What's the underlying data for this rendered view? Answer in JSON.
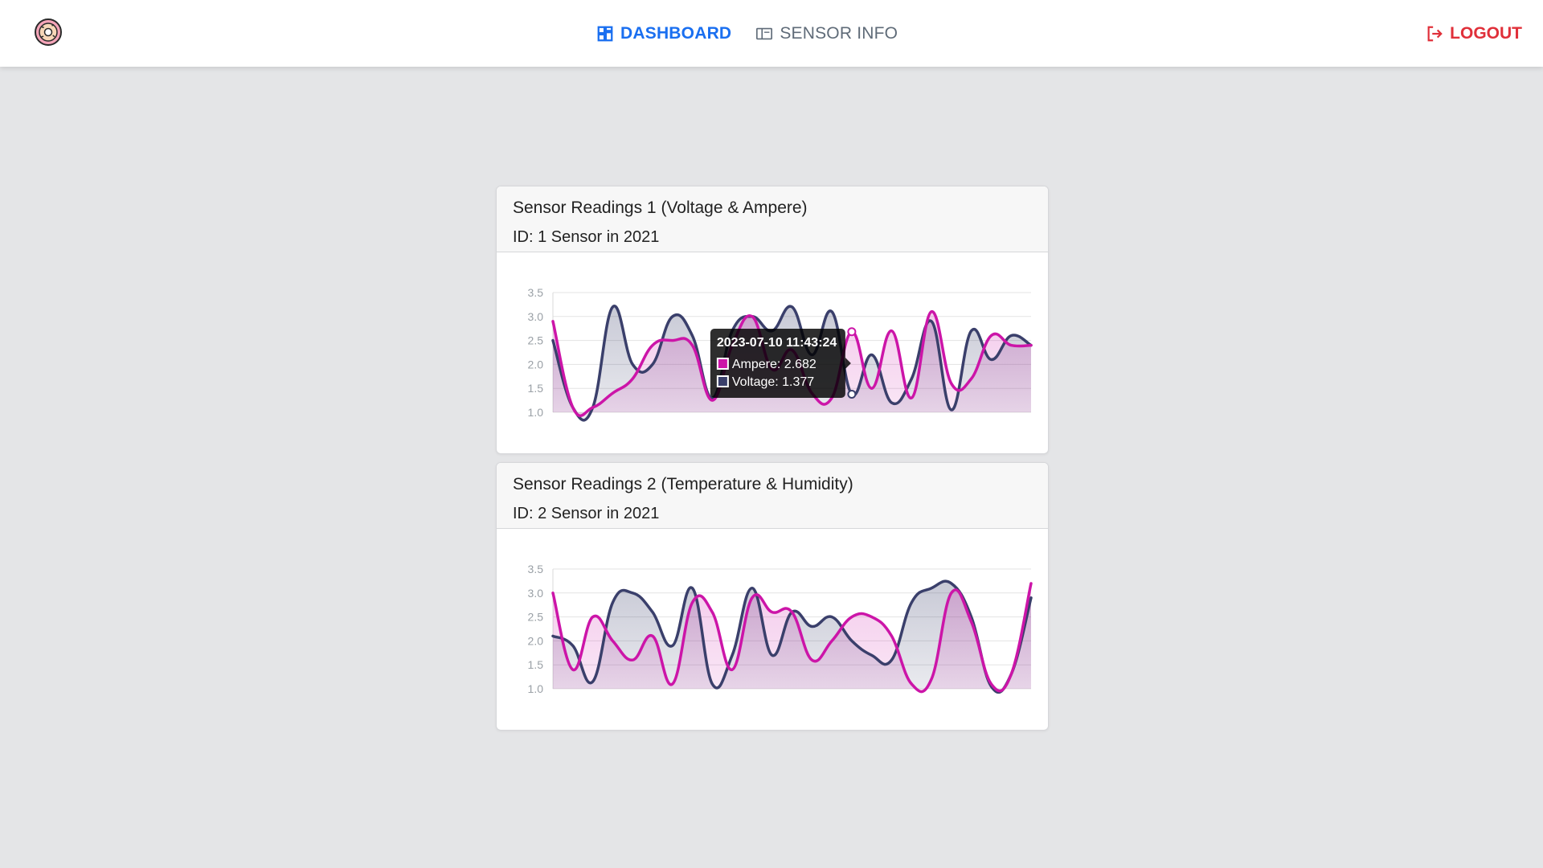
{
  "nav": {
    "dashboard_label": "DASHBOARD",
    "sensor_info_label": "SENSOR INFO",
    "logout_label": "LOGOUT"
  },
  "colors": {
    "accent": "#1a6ff0",
    "danger": "#e0303a",
    "ampere": "#cc15a8",
    "voltage": "#3a3f6b"
  },
  "cards": [
    {
      "title": "Sensor Readings 1 (Voltage & Ampere)",
      "subtitle": "ID: 1 Sensor in 2021"
    },
    {
      "title": "Sensor Readings 2 (Temperature & Humidity)",
      "subtitle": "ID: 2 Sensor in 2021"
    }
  ],
  "chart_data": [
    {
      "type": "line",
      "ylim": [
        1.0,
        3.5
      ],
      "yticks": [
        "3.5",
        "3.0",
        "2.5",
        "2.0",
        "1.5",
        "1.0"
      ],
      "grid": true,
      "filled": true,
      "series": [
        {
          "color": "#3a3f6b",
          "values": [
            2.5,
            1.1,
            1.1,
            3.2,
            2.0,
            2.0,
            3.0,
            2.6,
            1.3,
            2.7,
            3.0,
            2.7,
            3.2,
            2.2,
            3.1,
            1.377,
            2.2,
            1.2,
            1.7,
            2.9,
            1.05,
            2.7,
            2.1,
            2.6,
            2.4
          ]
        },
        {
          "color": "#cc15a8",
          "values": [
            2.9,
            1.1,
            1.1,
            1.4,
            1.7,
            2.4,
            2.5,
            2.4,
            1.25,
            2.4,
            3.0,
            1.9,
            2.3,
            1.4,
            1.3,
            2.682,
            1.5,
            2.7,
            1.3,
            3.1,
            1.6,
            1.7,
            2.6,
            2.4,
            2.4
          ]
        }
      ],
      "tooltip": {
        "title": "2023-07-10 11:43:24",
        "lines": [
          "Ampere: 2.682",
          "Voltage: 1.377"
        ],
        "index": 15
      }
    },
    {
      "type": "line",
      "ylim": [
        1.0,
        3.5
      ],
      "yticks": [
        "3.5",
        "3.0",
        "2.5",
        "2.0",
        "1.5",
        "1.0"
      ],
      "grid": true,
      "filled": true,
      "series": [
        {
          "color": "#3a3f6b",
          "values": [
            2.1,
            1.9,
            1.15,
            2.8,
            3.0,
            2.6,
            1.9,
            3.1,
            1.1,
            1.7,
            3.1,
            1.7,
            2.6,
            2.3,
            2.5,
            2.0,
            1.7,
            1.6,
            2.8,
            3.1,
            3.2,
            2.5,
            1.05,
            1.3,
            2.9
          ]
        },
        {
          "color": "#cc15a8",
          "values": [
            3.0,
            1.4,
            2.5,
            2.0,
            1.6,
            2.1,
            1.1,
            2.8,
            2.6,
            1.4,
            2.9,
            2.6,
            2.6,
            1.6,
            2.0,
            2.5,
            2.5,
            2.1,
            1.1,
            1.2,
            3.0,
            2.4,
            1.1,
            1.3,
            3.2
          ]
        }
      ]
    }
  ]
}
